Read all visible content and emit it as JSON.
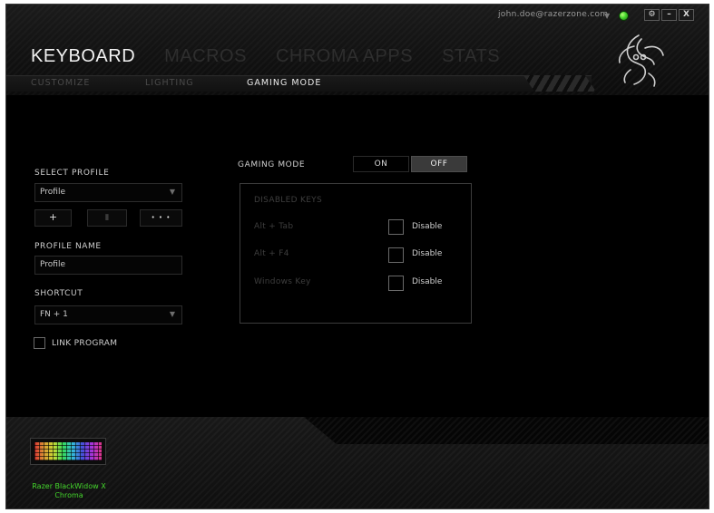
{
  "account": {
    "email": "john.doe@razerzone.com"
  },
  "window_controls": {
    "settings": "⚙",
    "minimize": "–",
    "close": "X"
  },
  "main_tabs": [
    "KEYBOARD",
    "MACROS",
    "CHROMA APPS",
    "STATS"
  ],
  "sub_tabs": [
    "CUSTOMIZE",
    "LIGHTING",
    "GAMING MODE"
  ],
  "left_panel": {
    "select_profile_label": "SELECT PROFILE",
    "profile_value": "Profile",
    "add_button": "+",
    "delete_button": "▮",
    "more_button": "• • •",
    "profile_name_label": "PROFILE NAME",
    "profile_name_value": "Profile",
    "shortcut_label": "SHORTCUT",
    "shortcut_value": "FN + 1",
    "link_program_label": "LINK PROGRAM",
    "dropdown_caret": "▼"
  },
  "gaming_mode": {
    "label": "GAMING MODE",
    "on_label": "ON",
    "off_label": "OFF",
    "state": "OFF",
    "disabled_keys_title": "DISABLED KEYS",
    "keys": [
      {
        "name": "Alt + Tab",
        "option": "Disable",
        "checked": false
      },
      {
        "name": "Alt + F4",
        "option": "Disable",
        "checked": false
      },
      {
        "name": "Windows Key",
        "option": "Disable",
        "checked": false
      }
    ]
  },
  "device": {
    "name_line1": "Razer BlackWidow X",
    "name_line2": "Chroma"
  },
  "colors": {
    "accent": "#44d62c",
    "background": "#000000",
    "active_text": "#f2f2f2",
    "inactive_text": "#2e2e2e"
  }
}
